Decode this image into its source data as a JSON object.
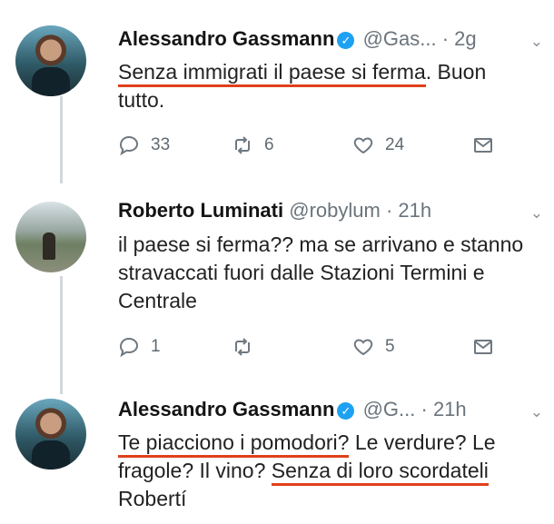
{
  "tweets": [
    {
      "name": "Alessandro Gassmann",
      "handle": "@Gas...",
      "separator": "·",
      "time": "2g",
      "text_underlined": "Senza immigrati il paese si ferma",
      "text_rest": ". Buon tutto.",
      "replies": "33",
      "retweets": "6",
      "likes": "24"
    },
    {
      "name": "Roberto Luminati",
      "handle": "@robylum",
      "separator": "·",
      "time": "21h",
      "text": "il paese si ferma?? ma se arrivano e stanno stravaccati fuori dalle Stazioni Termini e Centrale",
      "replies": "1",
      "retweets": "",
      "likes": "5"
    },
    {
      "name": "Alessandro Gassmann",
      "handle": "@G...",
      "separator": "·",
      "time": "21h",
      "text_underlined_1": "Te piacciono i pomodori?",
      "text_middle": " Le verdure? Le fragole? Il vino? ",
      "text_underlined_2": "Senza di loro scordateli",
      "text_end": " Robertí"
    }
  ],
  "icons": {
    "reply": "reply-icon",
    "retweet": "retweet-icon",
    "like": "heart-icon",
    "dm": "envelope-icon",
    "verified": "verified-badge-icon",
    "more": "chevron-down-icon"
  },
  "colors": {
    "underline": "#e0401a",
    "verified": "#1da1f2",
    "thread_line": "#d3d7db"
  }
}
